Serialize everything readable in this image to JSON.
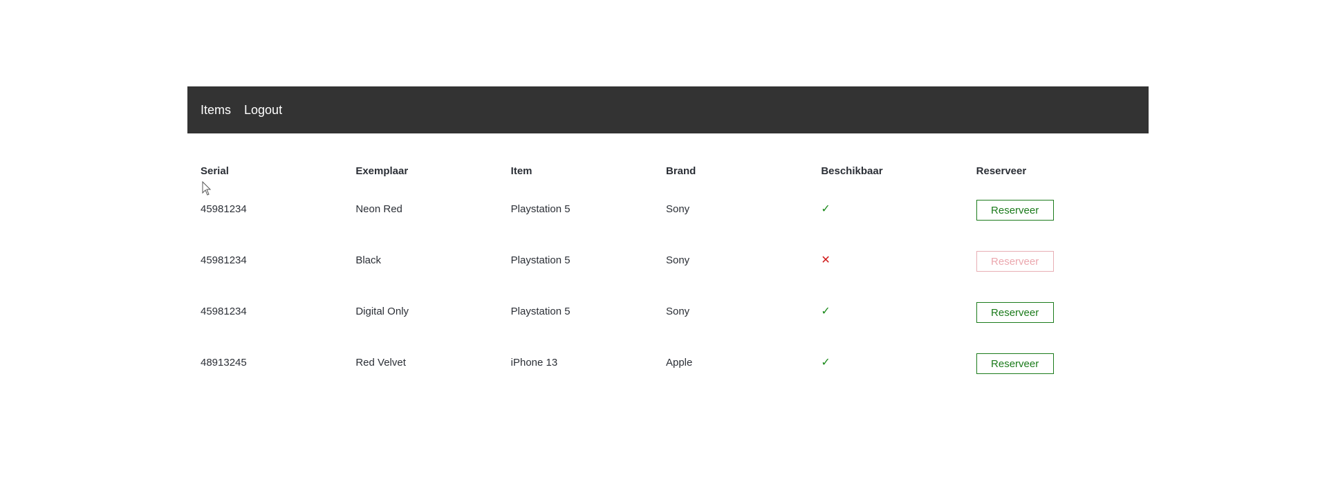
{
  "nav": {
    "items_label": "Items",
    "logout_label": "Logout"
  },
  "table": {
    "headers": [
      "Serial",
      "Exemplaar",
      "Item",
      "Brand",
      "Beschikbaar",
      "Reserveer"
    ],
    "rows": [
      {
        "serial": "45981234",
        "exemplaar": "Neon Red",
        "item": "Playstation 5",
        "brand": "Sony",
        "available": true,
        "status_glyph": "✓",
        "button_label": "Reserveer"
      },
      {
        "serial": "45981234",
        "exemplaar": "Black",
        "item": "Playstation 5",
        "brand": "Sony",
        "available": false,
        "status_glyph": "✕",
        "button_label": "Reserveer"
      },
      {
        "serial": "45981234",
        "exemplaar": "Digital Only",
        "item": "Playstation 5",
        "brand": "Sony",
        "available": true,
        "status_glyph": "✓",
        "button_label": "Reserveer"
      },
      {
        "serial": "48913245",
        "exemplaar": "Red Velvet",
        "item": "iPhone 13",
        "brand": "Apple",
        "available": true,
        "status_glyph": "✓",
        "button_label": "Reserveer"
      }
    ]
  },
  "colors": {
    "navbar_bg": "#333333",
    "available": "#1b8a1b",
    "unavailable": "#d11a1a",
    "button_enabled": "#1a7a1a",
    "button_disabled": "#eba7ae"
  }
}
